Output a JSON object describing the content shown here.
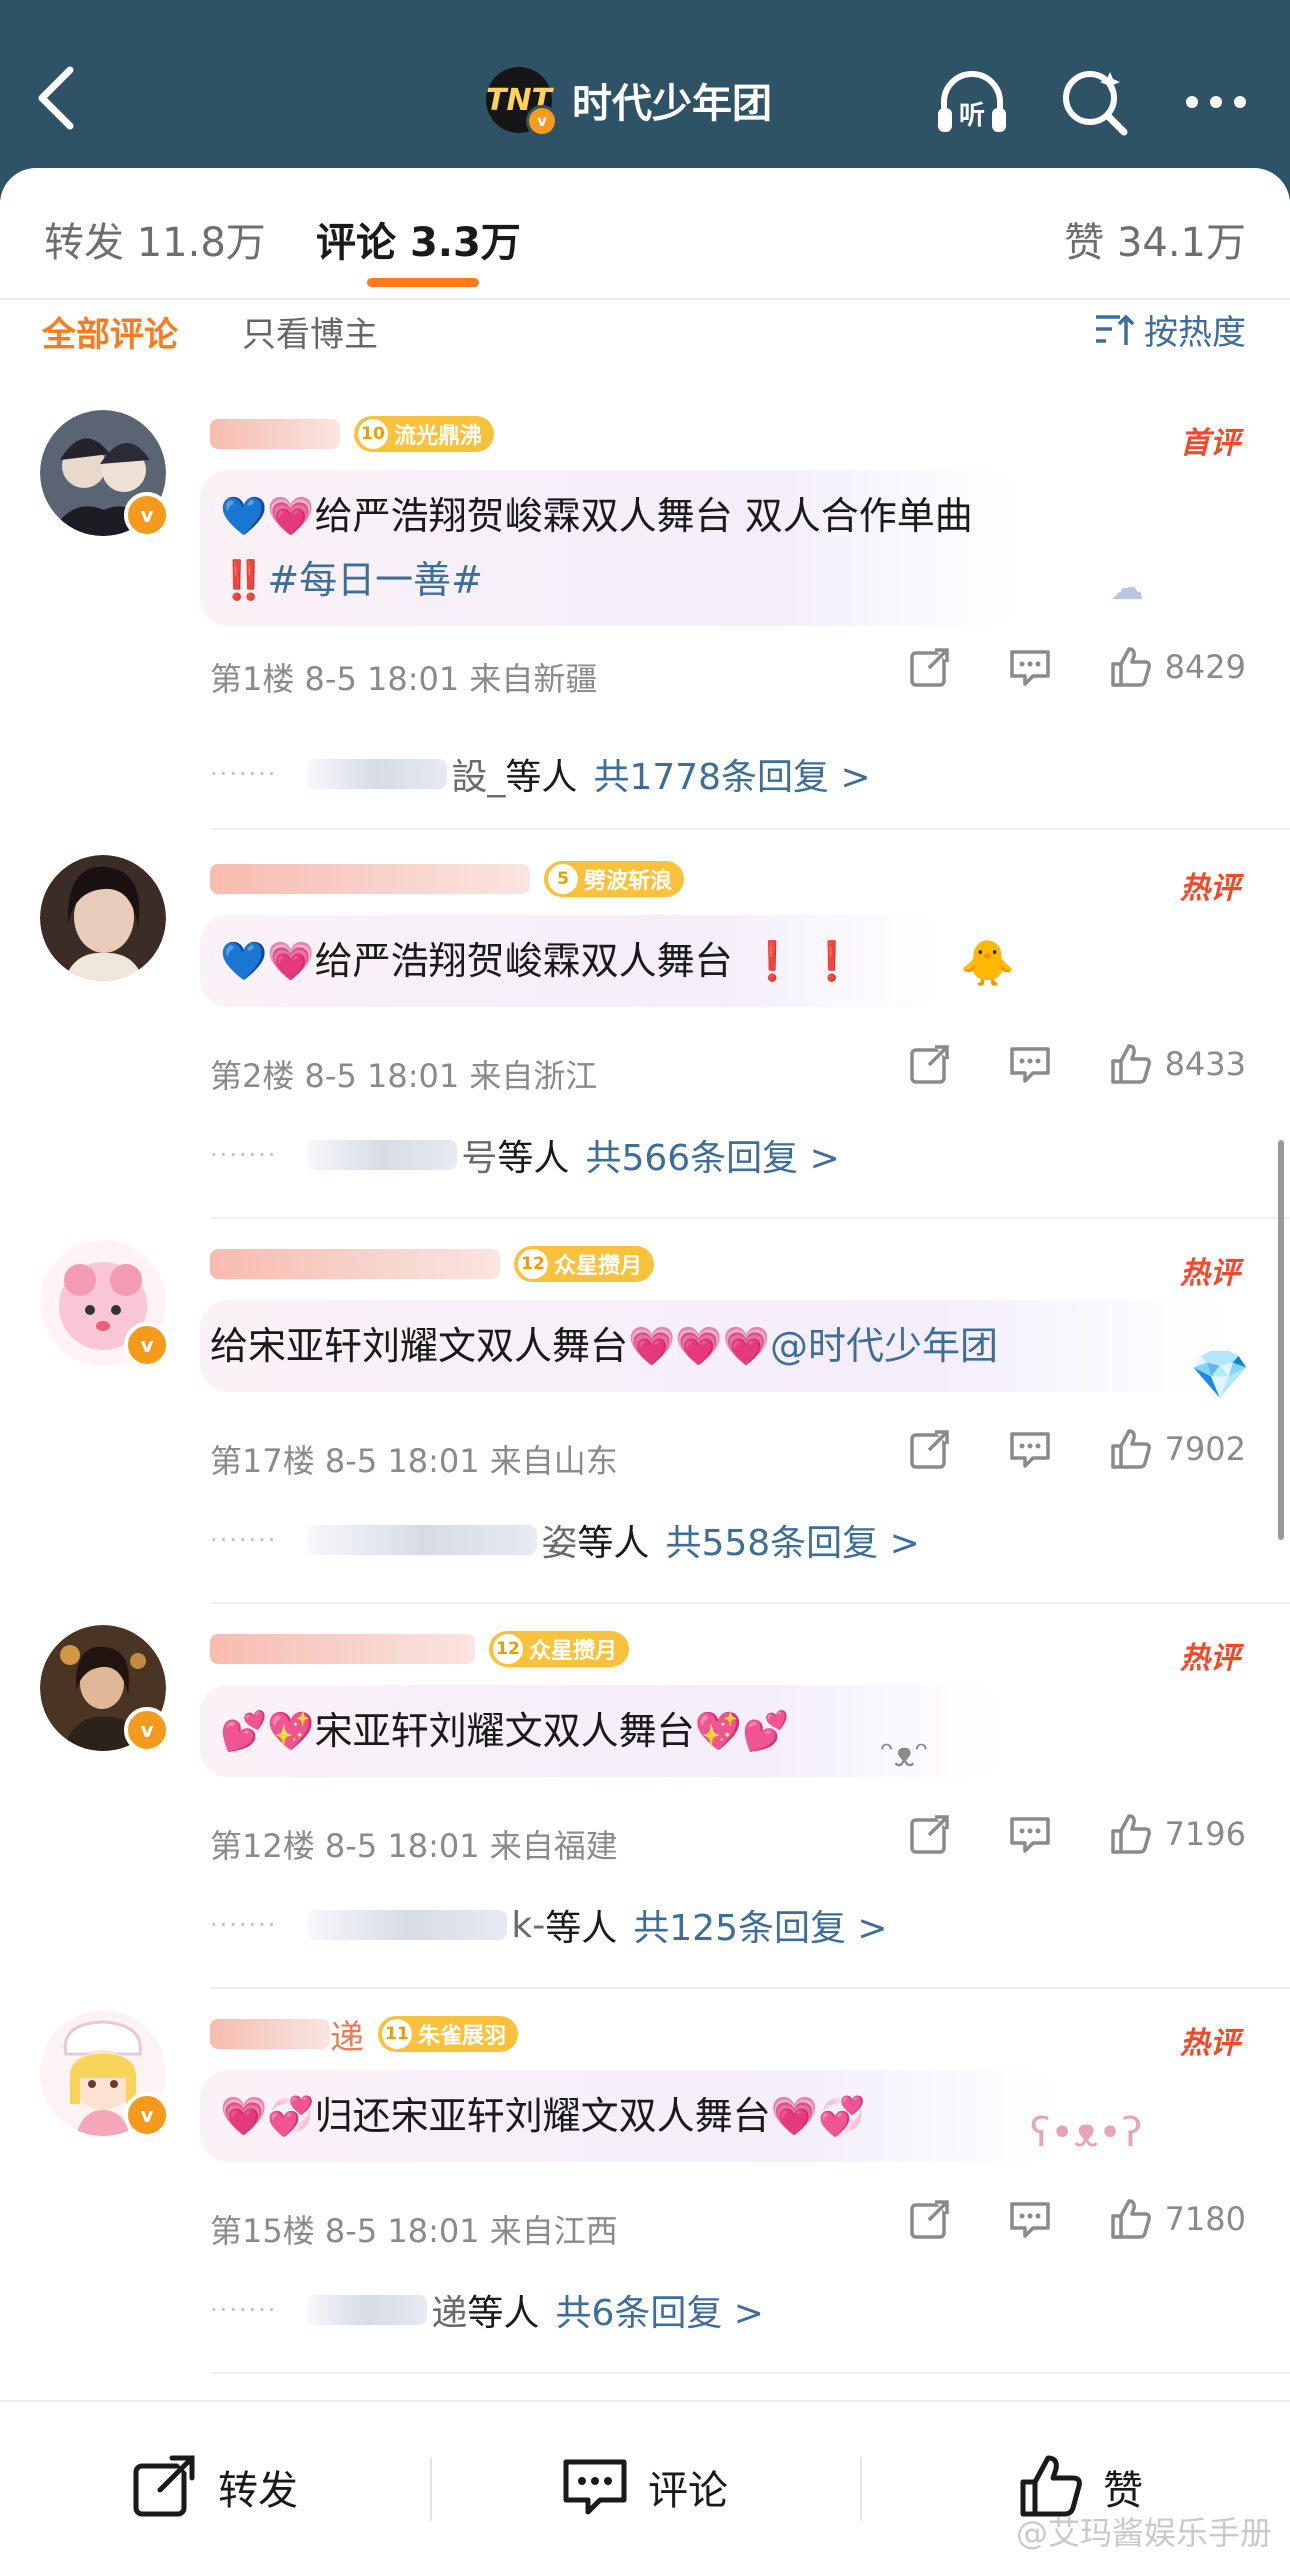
{
  "header": {
    "account_name": "时代少年团",
    "logo_text": "TNT",
    "listen_label": "听",
    "verified_mark": "v"
  },
  "tabs": [
    {
      "label": "转发",
      "count": "11.8万"
    },
    {
      "label": "评论",
      "count": "3.3万"
    },
    {
      "label": "赞",
      "count": "34.1万"
    }
  ],
  "filters": {
    "all": "全部评论",
    "blogger_only": "只看博主",
    "sort": "按热度"
  },
  "comments": [
    {
      "fan_level": "10",
      "fan_title": "流光鼎沸",
      "badge": "首评",
      "text_main": "给严浩翔贺峻霖双人舞台 双人合作单曲 ",
      "text_tag": "#每日一善#",
      "emoji_lead": "💙💗",
      "emoji_tail": "‼️",
      "floor": "第1楼",
      "time": "8-5 18:01",
      "location": "来自新疆",
      "likes": "8429",
      "reply_name": "設_",
      "reply_suffix": "等人",
      "reply_total": "共1778条回复 >"
    },
    {
      "fan_level": "5",
      "fan_title": "劈波斩浪",
      "badge": "热评",
      "text_main": "给严浩翔贺峻霖双人舞台",
      "text_tag": "",
      "emoji_lead": "💙💗",
      "emoji_tail": "❗ ❗",
      "floor": "第2楼",
      "time": "8-5 18:01",
      "location": "来自浙江",
      "likes": "8433",
      "reply_name": "号",
      "reply_suffix": "等人",
      "reply_total": "共566条回复 >"
    },
    {
      "fan_level": "12",
      "fan_title": "众星攒月",
      "badge": "热评",
      "text_main": "给宋亚轩刘耀文双人舞台",
      "text_tag": "@时代少年团",
      "emoji_lead": "",
      "emoji_tail": "💗💗💗",
      "floor": "第17楼",
      "time": "8-5 18:01",
      "location": "来自山东",
      "likes": "7902",
      "reply_name": "姿",
      "reply_suffix": "等人",
      "reply_total": "共558条回复 >"
    },
    {
      "fan_level": "12",
      "fan_title": "众星攒月",
      "badge": "热评",
      "text_main": "宋亚轩刘耀文双人舞台",
      "text_tag": "",
      "emoji_lead": "💕💖",
      "emoji_tail": "💖💕",
      "floor": "第12楼",
      "time": "8-5 18:01",
      "location": "来自福建",
      "likes": "7196",
      "reply_name": "k-",
      "reply_suffix": "等人",
      "reply_total": "共125条回复 >"
    },
    {
      "fan_level": "11",
      "fan_title": "朱雀展羽",
      "badge": "热评",
      "text_main": "归还宋亚轩刘耀文双人舞台",
      "text_tag": "",
      "emoji_lead": "💗💞",
      "emoji_tail": "💗💞",
      "floor": "第15楼",
      "time": "8-5 18:01",
      "location": "来自江西",
      "likes": "7180",
      "reply_name": "递",
      "reply_suffix": "等人",
      "reply_total": "共6条回复 >",
      "name_visible": "递"
    }
  ],
  "bottom_bar": {
    "repost": "转发",
    "comment": "评论",
    "like": "赞"
  },
  "watermark": "@艾玛酱娱乐手册",
  "colors": {
    "header_bg": "#2f5366",
    "accent": "#ff7a1a",
    "link": "#3d6e9a",
    "hot_badge": "#f5482a",
    "fan_badge": "#f9c23a"
  }
}
